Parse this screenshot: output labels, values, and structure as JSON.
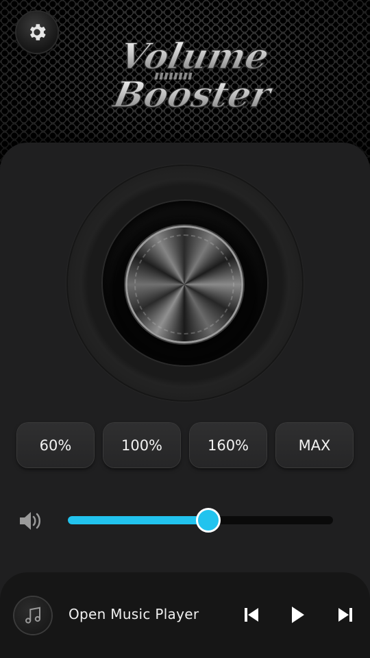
{
  "header": {
    "logo_line1": "Volume",
    "logo_line2": "Booster",
    "settings_icon": "gear-icon"
  },
  "presets": [
    {
      "label": "60%"
    },
    {
      "label": "100%"
    },
    {
      "label": "160%"
    },
    {
      "label": "MAX"
    }
  ],
  "volume": {
    "icon": "speaker-icon",
    "level": 0.53,
    "accent_color": "#22c3ee"
  },
  "player": {
    "label": "Open Music Player",
    "music_icon": "music-note-icon",
    "prev_icon": "skip-previous-icon",
    "play_icon": "play-icon",
    "next_icon": "skip-next-icon"
  }
}
